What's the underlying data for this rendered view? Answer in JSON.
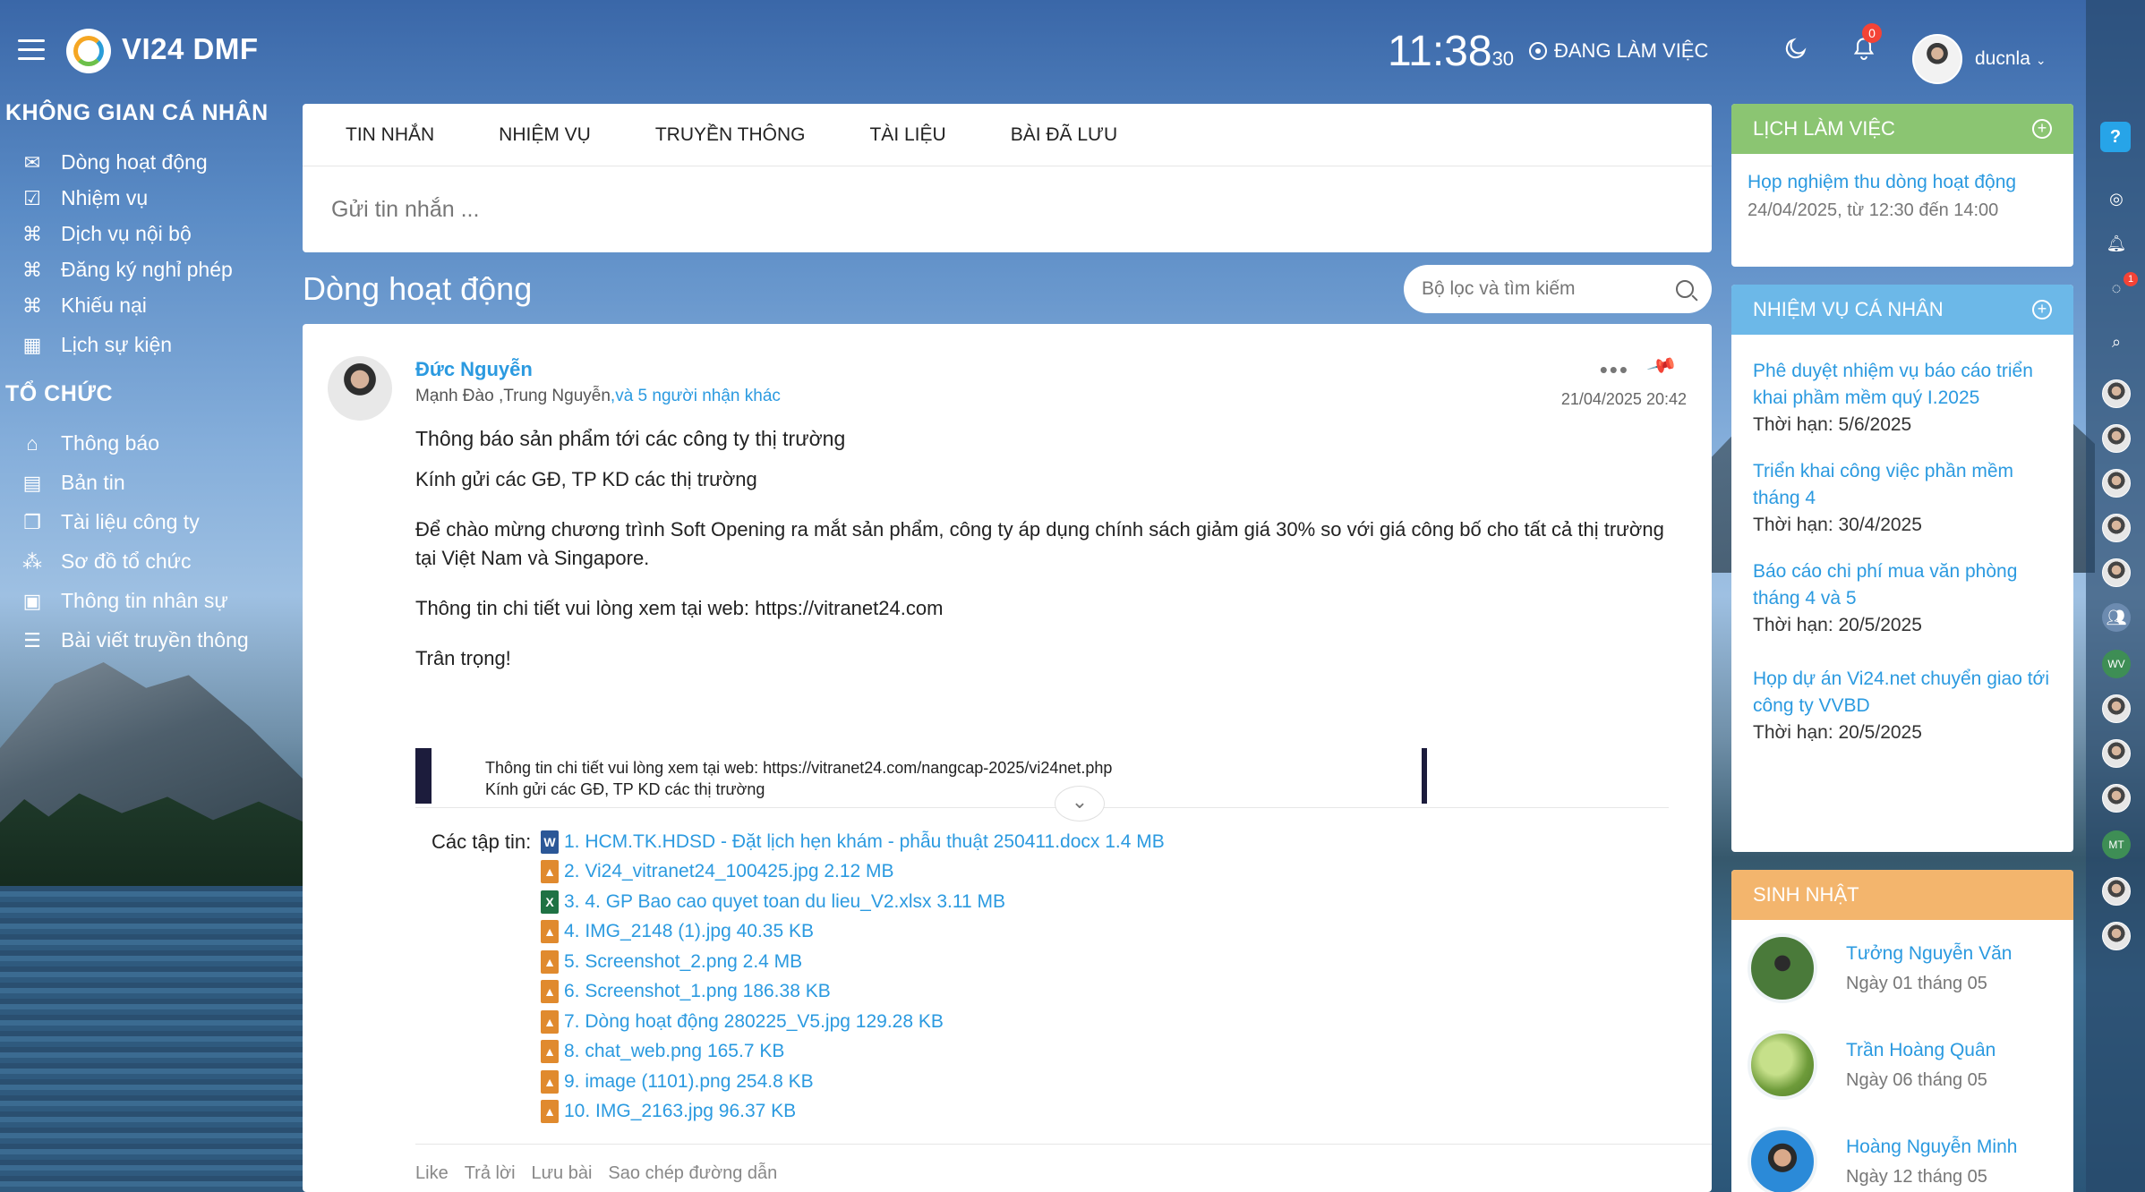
{
  "app": {
    "title": "VI24 DMF"
  },
  "header": {
    "clock_main": "11:38",
    "clock_seconds": "30",
    "work_status": "ĐANG LÀM VIỆC",
    "notification_count": "0",
    "user_name": "ducnla"
  },
  "sidebar": {
    "personal_heading": "KHÔNG GIAN CÁ NHÂN",
    "personal_items": [
      {
        "label": "Dòng hoạt động",
        "icon": "inbox-icon"
      },
      {
        "label": "Nhiệm vụ",
        "icon": "checkbox-icon"
      },
      {
        "label": "Dịch vụ nội bộ",
        "icon": "command-icon"
      },
      {
        "label": "Đăng ký nghỉ phép",
        "icon": "command-icon"
      },
      {
        "label": "Khiếu nại",
        "icon": "command-icon"
      },
      {
        "label": "Lịch sự kiện",
        "icon": "calendar-icon"
      }
    ],
    "org_heading": "TỔ CHỨC",
    "org_items": [
      {
        "label": "Thông báo",
        "icon": "home-icon"
      },
      {
        "label": "Bản tin",
        "icon": "newspaper-icon"
      },
      {
        "label": "Tài liệu công ty",
        "icon": "documents-icon"
      },
      {
        "label": "Sơ đồ tổ chức",
        "icon": "org-chart-icon"
      },
      {
        "label": "Thông tin nhân sự",
        "icon": "id-card-icon"
      },
      {
        "label": "Bài viết truyền thông",
        "icon": "list-icon"
      }
    ]
  },
  "composer": {
    "tabs": [
      "TIN NHẮN",
      "NHIỆM VỤ",
      "TRUYỀN THÔNG",
      "TÀI LIỆU",
      "BÀI ĐÃ LƯU"
    ],
    "placeholder": "Gửi tin nhắn ..."
  },
  "feed": {
    "title": "Dòng hoạt động",
    "filter_placeholder": "Bộ lọc và tìm kiếm"
  },
  "post": {
    "author": "Đức Nguyễn",
    "recipients": "Mạnh Đào ,Trung Nguyễn",
    "recipients_more": ",và 5 người nhận khác",
    "date": "21/04/2025 20:42",
    "subject": "Thông báo sản phẩm tới các công ty thị trường",
    "greeting": "Kính gửi các GĐ, TP KD các thị trường",
    "body": "Để chào mừng chương trình Soft Opening ra mắt sản phẩm, công ty áp dụng chính sách giảm giá 30% so với giá công bố cho tất cả thị trường tại Việt Nam và Singapore.",
    "info": "Thông tin chi tiết vui lòng xem tại web: https://vitranet24.com",
    "closing": "Trân trọng!",
    "preview_line1": "Thông tin chi tiết vui lòng xem tại web: https://vitranet24.com/nangcap-2025/vi24net.php",
    "preview_line2": "Kính gửi các GĐ, TP KD các thị trường",
    "files_label": "Các tập tin:",
    "files": [
      {
        "name": "1. HCM.TK.HDSD - Đặt lịch hẹn khám - phẫu thuật 250411.docx 1.4 MB",
        "type": "word"
      },
      {
        "name": "2. Vi24_vitranet24_100425.jpg 2.12 MB",
        "type": "img"
      },
      {
        "name": "3. 4. GP Bao cao quyet toan du lieu_V2.xlsx 3.11 MB",
        "type": "excel"
      },
      {
        "name": "4. IMG_2148 (1).jpg 40.35 KB",
        "type": "img"
      },
      {
        "name": "5. Screenshot_2.png 2.4 MB",
        "type": "img"
      },
      {
        "name": "6. Screenshot_1.png 186.38 KB",
        "type": "img"
      },
      {
        "name": "7. Dòng hoạt động 280225_V5.jpg 129.28 KB",
        "type": "img"
      },
      {
        "name": "8. chat_web.png 165.7 KB",
        "type": "img"
      },
      {
        "name": "9. image (1101).png 254.8 KB",
        "type": "img"
      },
      {
        "name": "10. IMG_2163.jpg 96.37 KB",
        "type": "img"
      }
    ],
    "actions": [
      "Like",
      "Trả lời",
      "Lưu bài",
      "Sao chép đường dẫn"
    ]
  },
  "schedule": {
    "heading": "LỊCH LÀM VIỆC",
    "event_title": "Họp nghiệm thu dòng hoạt động",
    "event_time": "24/04/2025, từ 12:30 đến 14:00"
  },
  "tasks": {
    "heading": "NHIỆM VỤ CÁ NHÂN",
    "items": [
      {
        "title": "Phê duyệt nhiệm vụ báo cáo triển khai phầm mềm quý I.2025",
        "deadline": "Thời hạn: 5/6/2025"
      },
      {
        "title": "Triển khai công việc phần mềm tháng 4",
        "deadline": "Thời hạn: 30/4/2025"
      },
      {
        "title": "Báo cáo chi phí mua văn phòng tháng 4 và 5",
        "deadline": "Thời hạn: 20/5/2025"
      },
      {
        "title": "Họp dự án Vi24.net chuyển giao tới công ty VVBD",
        "deadline": "Thời hạn: 20/5/2025"
      }
    ]
  },
  "birthdays": {
    "heading": "SINH NHẬT",
    "items": [
      {
        "name": "Tưởng Nguyễn Văn",
        "date": "Ngày 01 tháng 05"
      },
      {
        "name": "Trần Hoàng Quân",
        "date": "Ngày 06 tháng 05"
      },
      {
        "name": "Hoàng Nguyễn Minh",
        "date": "Ngày 12 tháng 05"
      }
    ]
  },
  "dock": {
    "help": "?",
    "chat_badge": "1",
    "initials": [
      "WV",
      "MT"
    ]
  },
  "colors": {
    "accent_blue": "#2b9ae0",
    "schedule_green": "#8bc572",
    "tasks_blue": "#6cb8e8",
    "birthday_orange": "#f3b56d",
    "notification_red": "#f44336"
  }
}
